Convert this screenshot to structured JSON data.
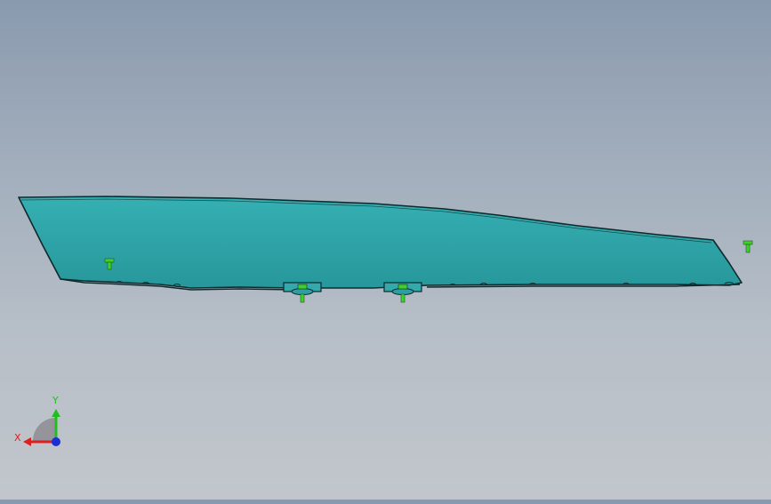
{
  "viewport": {
    "model": "glass-panel-part",
    "view": "front",
    "colors": {
      "background_top": "#8a9aae",
      "background_bottom": "#c2c6cc",
      "part_fill": "#2fa3a6",
      "part_edge": "#0e2a2c",
      "clip_fill": "#35a8ac",
      "fastener": "#3fd12a"
    }
  },
  "triad": {
    "x_label": "X",
    "y_label": "Y",
    "x_color": "#e01e1e",
    "y_color": "#1fbf1f",
    "z_color": "#1a2fd6"
  }
}
